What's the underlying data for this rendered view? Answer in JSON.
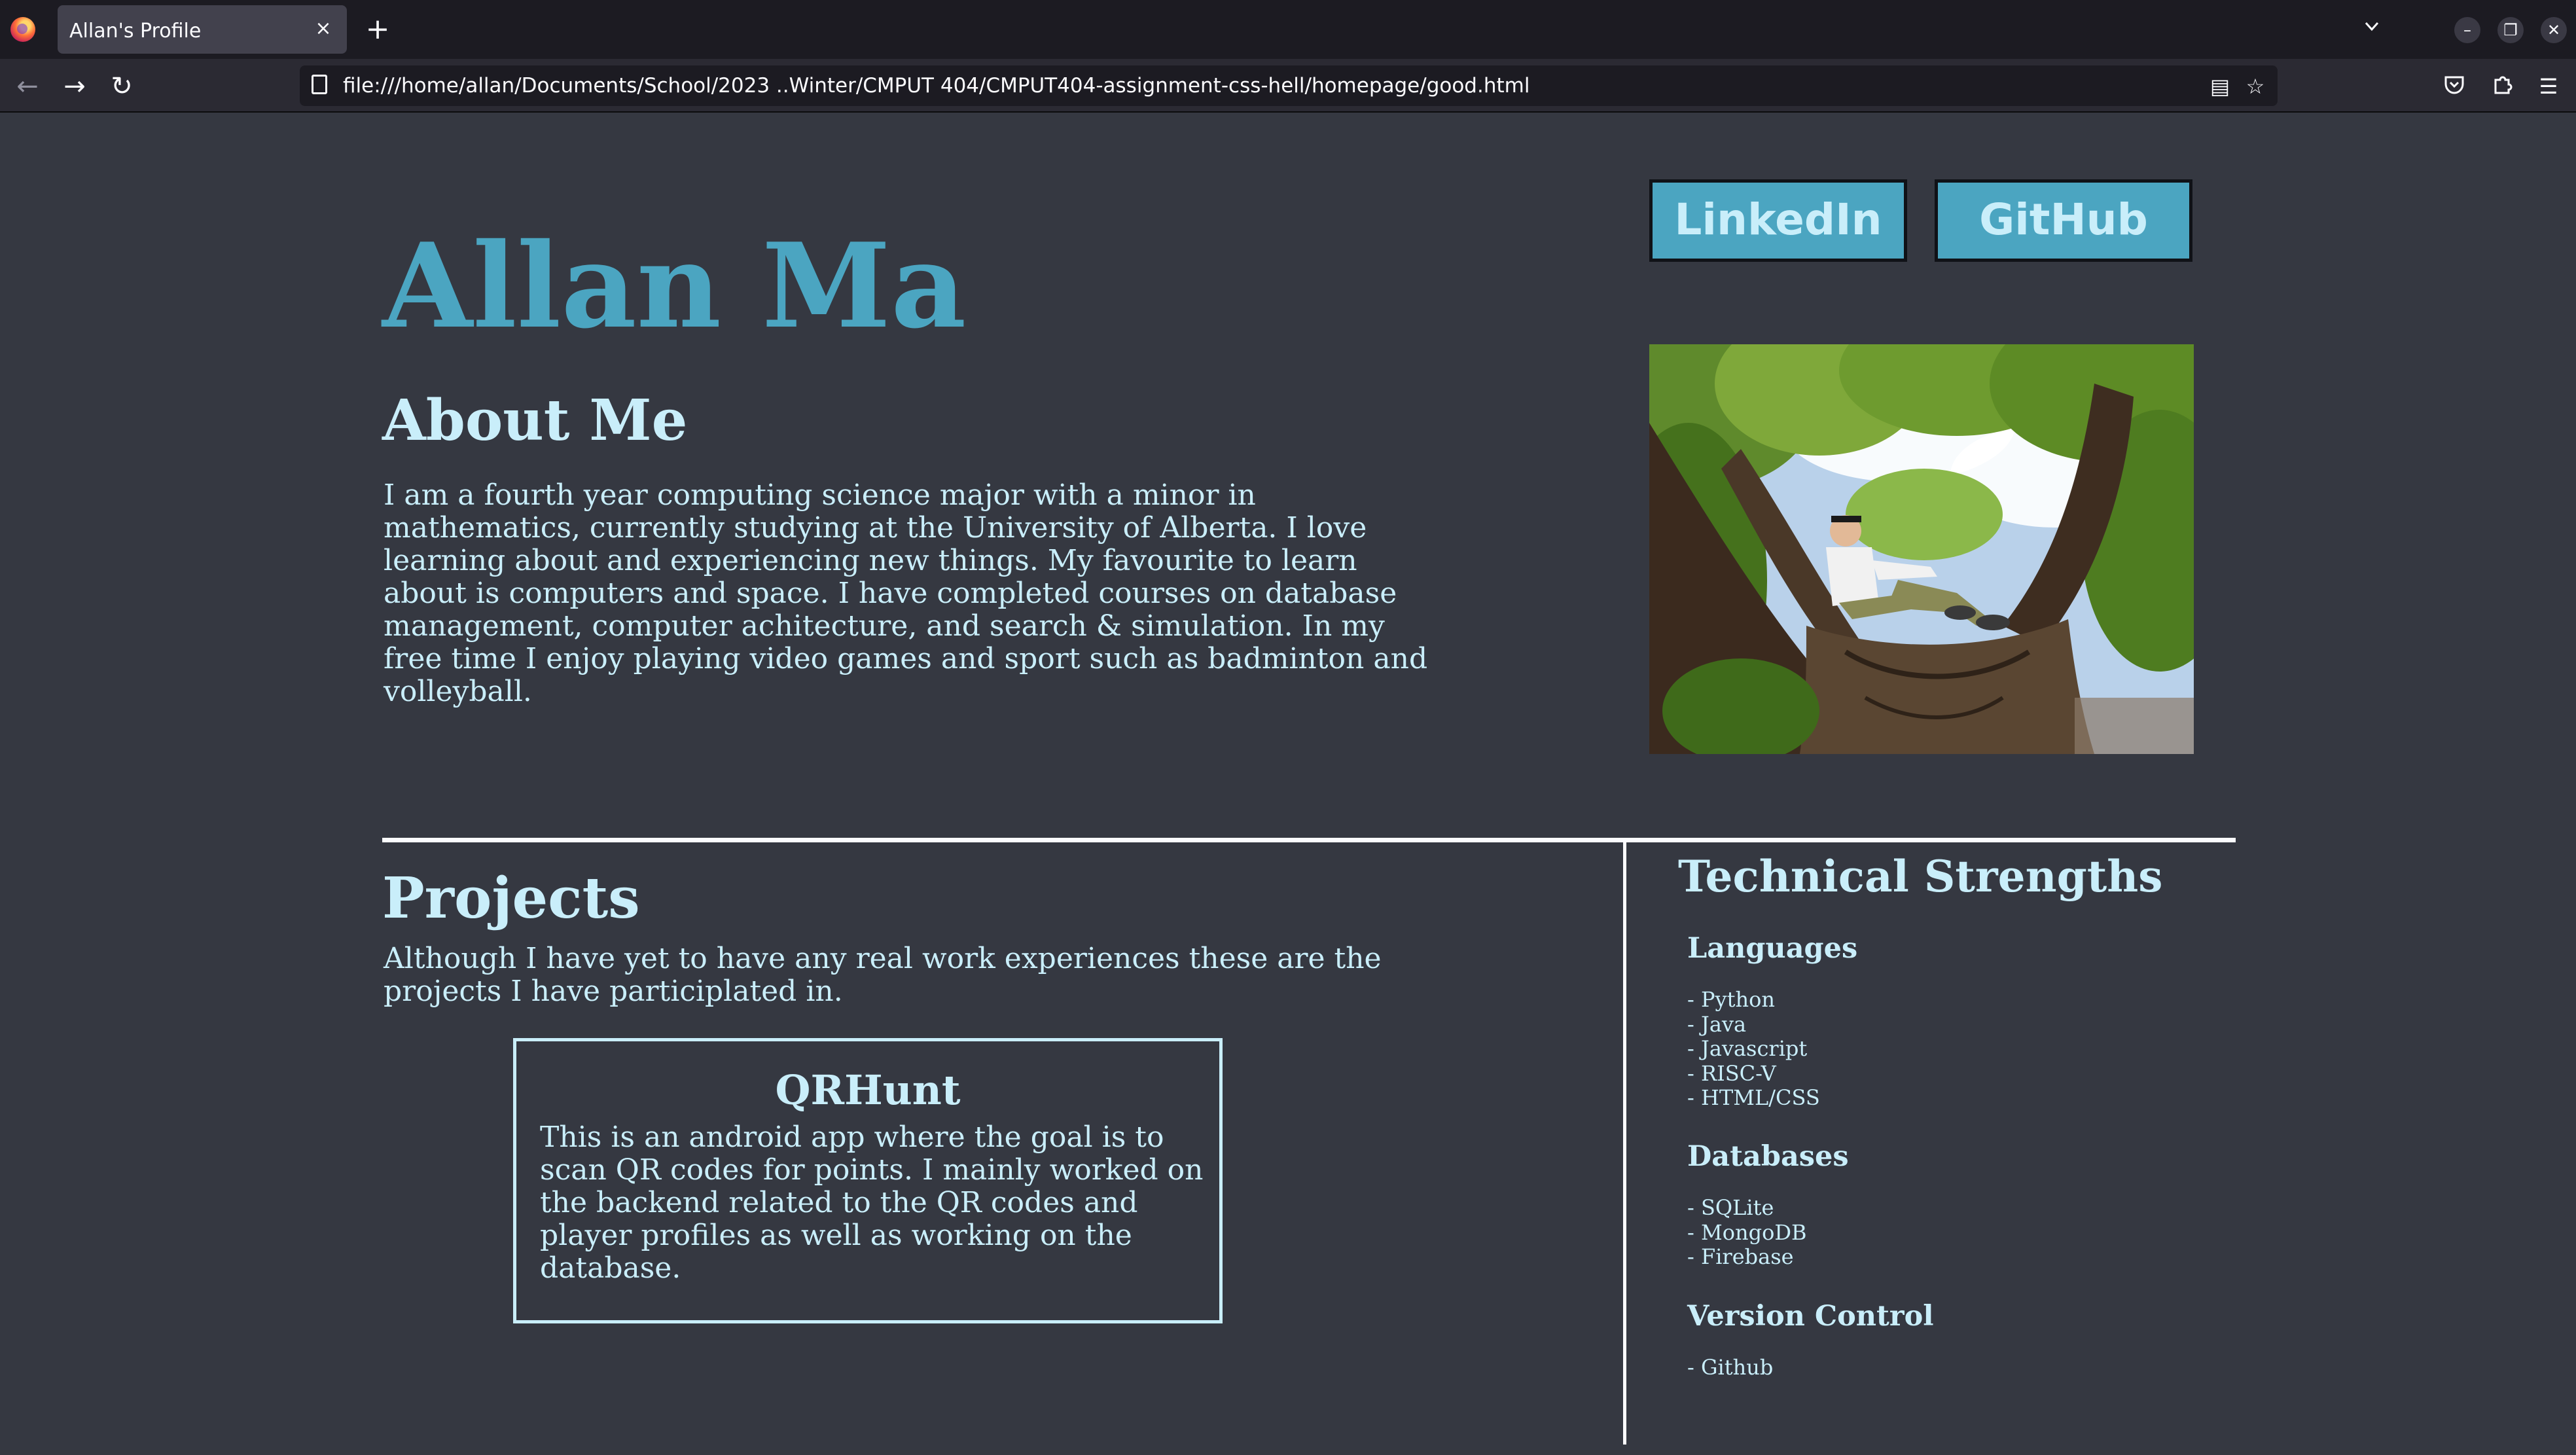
{
  "browser": {
    "tab_title": "Allan's Profile",
    "tab_close": "×",
    "new_tab": "+",
    "url": "file:///home/allan/Documents/School/2023 ..Winter/CMPUT 404/CMPUT404-assignment-css-hell/homepage/good.html"
  },
  "profile": {
    "name": "Allan Ma",
    "links": {
      "linkedin": "LinkedIn",
      "github": "GitHub"
    },
    "about_heading": "About Me",
    "about_text": "I am a fourth year computing science major with a minor in mathematics, currently studying at the University of Alberta. I love learning about and experiencing new things. My favourite to learn about is computers and space. I have completed courses on database management, computer achitecture, and search & simulation. In my free time I enjoy playing video games and sport such as badminton and volleyball."
  },
  "projects": {
    "heading": "Projects",
    "intro": "Although I have yet to have any real work experiences these are the projects I have participlated in.",
    "items": [
      {
        "title": "QRHunt",
        "description": "This is an android app where the goal is to scan QR codes for points. I mainly worked on the backend related to the QR codes and player profiles as well as working on the database."
      }
    ]
  },
  "technical": {
    "heading": "Technical Strengths",
    "sections": [
      {
        "title": "Languages",
        "items": [
          "- Python",
          "- Java",
          "- Javascript",
          "- RISC-V",
          "- HTML/CSS"
        ]
      },
      {
        "title": "Databases",
        "items": [
          "- SQLite",
          "- MongoDB",
          "- Firebase"
        ]
      },
      {
        "title": "Version Control",
        "items": [
          "- Github"
        ]
      }
    ]
  },
  "colors": {
    "page_bg": "#353841",
    "accent": "#4ba5c1",
    "text": "#c9eefa"
  }
}
